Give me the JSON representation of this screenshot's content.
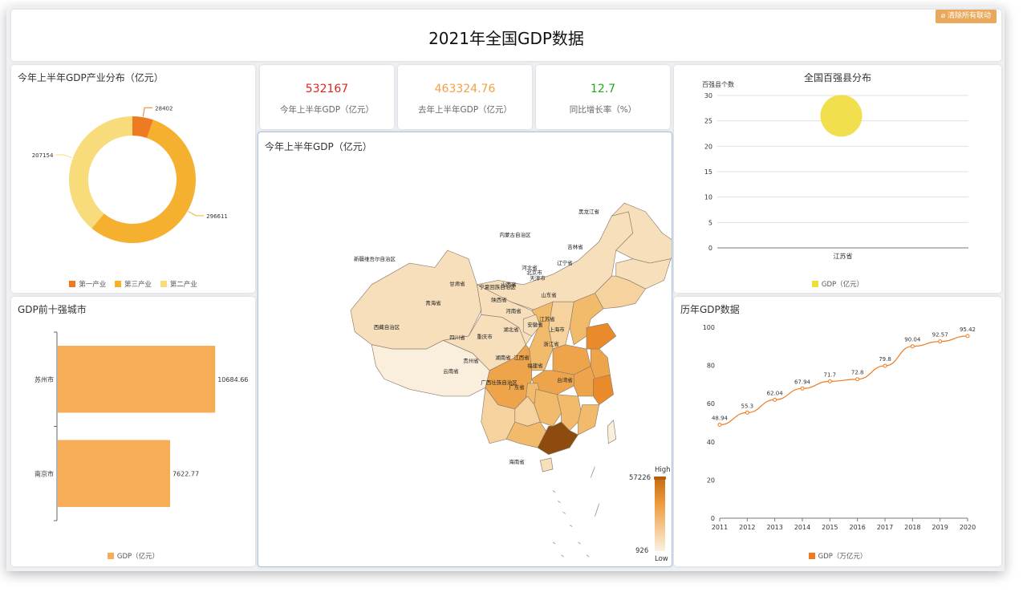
{
  "header": {
    "title": "2021年全国GDP数据",
    "clear_label": "清除所有联动"
  },
  "colors": {
    "primary": "#ee7b22",
    "secondary": "#f6b02f",
    "tertiary": "#f8dc7c",
    "bar": "#f7ac57",
    "scatter": "#f0dc3b",
    "red": "#e2231a",
    "orange": "#f4a044",
    "green": "#1fa91f"
  },
  "kpis": [
    {
      "value": "532167",
      "label": "今年上半年GDP（亿元）"
    },
    {
      "value": "463324.76",
      "label": "去年上半年GDP（亿元）"
    },
    {
      "value": "12.7",
      "label": "同比增长率（%）"
    }
  ],
  "donut": {
    "title": "今年上半年GDP产业分布（亿元）",
    "chart_data": {
      "type": "pie",
      "series": [
        {
          "name": "第一产业",
          "value": 28402
        },
        {
          "name": "第三产业",
          "value": 296611
        },
        {
          "name": "第二产业",
          "value": 207154
        }
      ]
    },
    "labels": [
      "28402",
      "296611",
      "207154"
    ],
    "legend": [
      "第一产业",
      "第三产业",
      "第二产业"
    ]
  },
  "top_cities": {
    "title": "GDP前十强城市",
    "chart_data": {
      "type": "bar",
      "categories": [
        "苏州市",
        "南京市"
      ],
      "values": [
        10684.66,
        7622.77
      ],
      "xlim": [
        0,
        11000
      ]
    },
    "value_labels": [
      "10684.66",
      "7622.77"
    ],
    "legend": "GDP（亿元）"
  },
  "map": {
    "title": "今年上半年GDP（亿元）",
    "visual_max": "57226",
    "visual_min": "926",
    "high_label": "High",
    "low_label": "Low",
    "province_labels": [
      "黑龙江省",
      "吉林省",
      "辽宁省",
      "内蒙古自治区",
      "新疆维吾尔自治区",
      "甘肃省",
      "宁夏回族自治区",
      "青海省",
      "西藏自治区",
      "山西省",
      "陕西省",
      "河南省",
      "山东省",
      "江苏省",
      "安徽省",
      "湖北省",
      "四川省",
      "重庆市",
      "湖南省",
      "江西省",
      "浙江省",
      "贵州省",
      "云南省",
      "福建省",
      "广西壮族自治区",
      "广东省",
      "台湾省",
      "海南省",
      "上海市",
      "北京市",
      "天津市",
      "河北省"
    ]
  },
  "scatter": {
    "title": "全国百强县分布",
    "chart_data": {
      "type": "scatter",
      "categories": [
        "江苏省"
      ],
      "values": [
        26
      ],
      "ylabel": "百强县个数",
      "ylim": [
        0,
        30
      ],
      "yticks": [
        0,
        5,
        10,
        15,
        20,
        25,
        30
      ]
    },
    "ytick_labels": [
      "0",
      "5",
      "10",
      "15",
      "20",
      "25",
      "30"
    ],
    "legend": "GDP（亿元）"
  },
  "history": {
    "title": "历年GDP数据",
    "chart_data": {
      "type": "line",
      "x": [
        "2011",
        "2012",
        "2013",
        "2014",
        "2015",
        "2016",
        "2017",
        "2018",
        "2019",
        "2020"
      ],
      "values": [
        48.94,
        55.3,
        62.04,
        67.94,
        71.7,
        72.8,
        79.8,
        90.04,
        92.57,
        95.42
      ],
      "ylim": [
        0,
        100
      ],
      "yticks": [
        0,
        20,
        40,
        60,
        80,
        100
      ]
    },
    "point_labels": [
      "48.94",
      "55.3",
      "62.04",
      "67.94",
      "71.7",
      "72.8",
      "79.8",
      "90.04",
      "92.57",
      "95.42"
    ],
    "ytick_labels": [
      "0",
      "20",
      "40",
      "60",
      "80",
      "100"
    ],
    "legend": "GDP（万亿元）"
  }
}
